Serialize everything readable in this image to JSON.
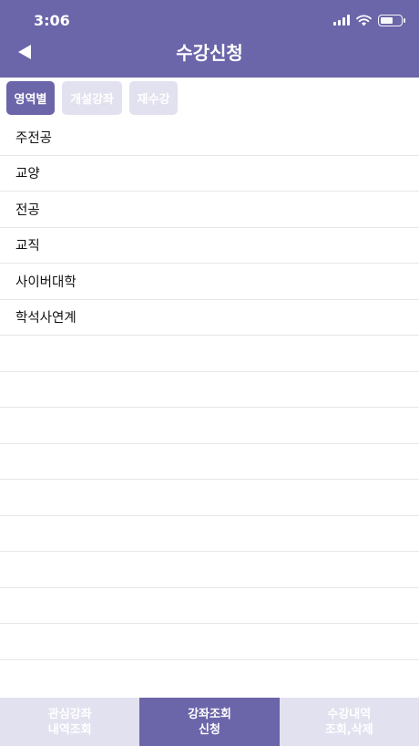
{
  "status_bar": {
    "time": "3:06"
  },
  "header": {
    "title": "수강신청",
    "back_icon": "back-arrow-icon"
  },
  "tabs": [
    {
      "label": "영역별",
      "active": true
    },
    {
      "label": "개설강좌",
      "active": false
    },
    {
      "label": "재수강",
      "active": false
    }
  ],
  "list": {
    "items": [
      "주전공",
      "교양",
      "전공",
      "교직",
      "사이버대학",
      "학석사연계"
    ]
  },
  "bottom_bar": {
    "buttons": [
      {
        "line1": "관심강좌",
        "line2": "내역조회",
        "active": false
      },
      {
        "line1": "강좌조회",
        "line2": "신청",
        "active": true
      },
      {
        "line1": "수강내역",
        "line2": "조회,삭제",
        "active": false
      }
    ]
  },
  "colors": {
    "primary": "#6b65a9",
    "inactive": "#e2e1ef"
  }
}
